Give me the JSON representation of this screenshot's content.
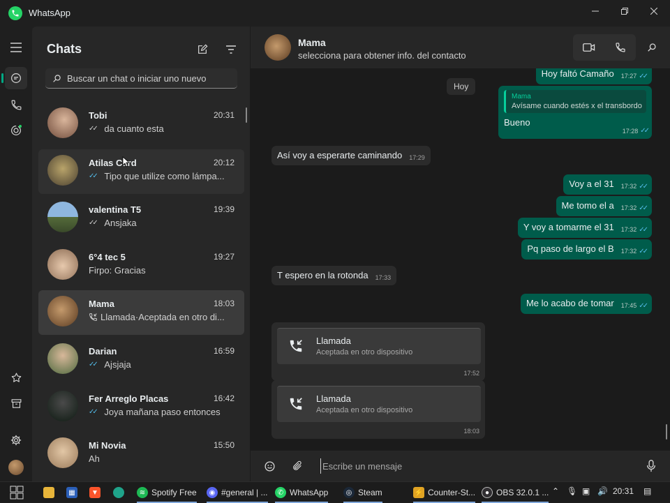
{
  "window": {
    "title": "WhatsApp",
    "controls": [
      "minimize",
      "maximize",
      "close"
    ]
  },
  "rail": {
    "top_items": [
      "menu-icon",
      "chats-icon",
      "calls-icon",
      "status-icon"
    ],
    "bottom_items": [
      "starred-icon",
      "archive-icon",
      "settings-icon",
      "profile-avatar"
    ]
  },
  "chatlist": {
    "title": "Chats",
    "search_placeholder": "Buscar un chat o iniciar uno nuevo",
    "items": [
      {
        "name": "Tobi",
        "time": "20:31",
        "preview": "da cuanto esta",
        "tick": "read-grey",
        "avatar_color": "#b58c72"
      },
      {
        "name": "Atilas Card",
        "time": "20:12",
        "preview": "Tipo que utilize como lámpa...",
        "tick": "read-blue",
        "avatar_color": "#8a7a4a"
      },
      {
        "name": "valentina T5",
        "time": "19:39",
        "preview": "Ansjaka",
        "tick": "read-grey",
        "avatar_color": "#6a8fb0"
      },
      {
        "name": "6°4 tec 5",
        "time": "19:27",
        "preview": "Firpo: Gracias",
        "tick": "none",
        "avatar_color": "#c9b6a0"
      },
      {
        "name": "Mama",
        "time": "18:03",
        "preview": "Llamada·Aceptada en otro di...",
        "tick": "call",
        "avatar_color": "#9a6a3a"
      },
      {
        "name": "Darian",
        "time": "16:59",
        "preview": "Ajsjaja",
        "tick": "read-blue",
        "avatar_color": "#6f8a5a"
      },
      {
        "name": "Fer Arreglo Placas",
        "time": "16:42",
        "preview": "Joya mañana paso entonces",
        "tick": "read-blue",
        "avatar_color": "#2e3a2e"
      },
      {
        "name": "Mi Novia",
        "time": "15:50",
        "preview": "Ah",
        "tick": "none",
        "avatar_color": "#c8a98a"
      }
    ]
  },
  "conversation": {
    "contact_name": "Mama",
    "contact_sub": "selecciona para obtener info. del contacto",
    "day_chip": "Hoy",
    "messages": [
      {
        "dir": "out",
        "text": "Hoy faltó Camaño",
        "time": "17:27"
      },
      {
        "dir": "out",
        "quote_name": "Mama",
        "quote_text": "Avísame cuando estés x el transbordo",
        "text": "Bueno",
        "time": "17:28"
      },
      {
        "dir": "in",
        "text": "Así voy a esperarte caminando",
        "time": "17:29"
      },
      {
        "dir": "out",
        "text": "Voy a el 31",
        "time": "17:32"
      },
      {
        "dir": "out",
        "text": "Me tomo el a",
        "time": "17:32"
      },
      {
        "dir": "out",
        "text": "Y voy a tomarme el 31",
        "time": "17:32"
      },
      {
        "dir": "out",
        "text": "Pq paso de largo el B",
        "time": "17:32"
      },
      {
        "dir": "in",
        "text": "T espero  en la rotonda",
        "time": "17:33"
      },
      {
        "dir": "out",
        "text": "Me lo acabo de tomar",
        "time": "17:45"
      }
    ],
    "calls": [
      {
        "title": "Llamada",
        "sub": "Aceptada en otro dispositivo",
        "time": "17:52"
      },
      {
        "title": "Llamada",
        "sub": "Aceptada en otro dispositivo",
        "time": "18:03"
      }
    ],
    "composer_placeholder": "Escribe un mensaje"
  },
  "taskbar": {
    "items": [
      {
        "label": "",
        "icon": "start-icon"
      },
      {
        "label": "",
        "icon": "file-explorer-icon"
      },
      {
        "label": "",
        "icon": "store-icon"
      },
      {
        "label": "",
        "icon": "brave-icon"
      },
      {
        "label": "",
        "icon": "edge-icon"
      },
      {
        "label": "Spotify Free",
        "icon": "spotify-icon"
      },
      {
        "label": "#general | ...",
        "icon": "discord-icon"
      },
      {
        "label": "WhatsApp",
        "icon": "whatsapp-icon"
      },
      {
        "label": "Steam",
        "icon": "steam-icon"
      },
      {
        "label": "Counter-St...",
        "icon": "counter-strike-icon"
      },
      {
        "label": "OBS 32.0.1 ...",
        "icon": "obs-icon"
      }
    ],
    "clock": "20:31"
  }
}
